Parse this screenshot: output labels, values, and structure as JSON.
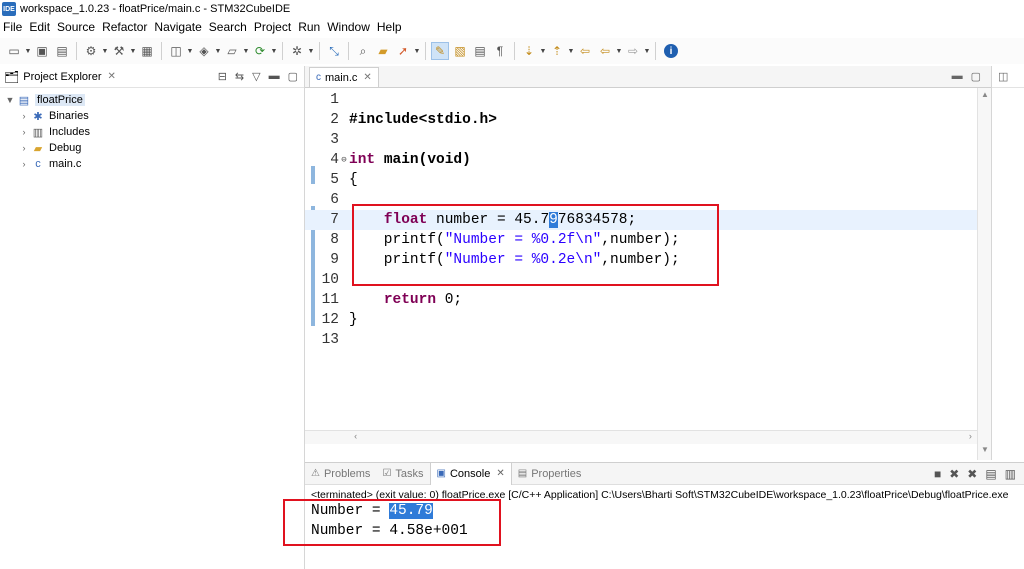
{
  "window": {
    "title": "workspace_1.0.23 - floatPrice/main.c - STM32CubeIDE",
    "app_icon": "IDE"
  },
  "menu": [
    "File",
    "Edit",
    "Source",
    "Refactor",
    "Navigate",
    "Search",
    "Project",
    "Run",
    "Window",
    "Help"
  ],
  "explorer": {
    "title": "Project Explorer",
    "tree": [
      {
        "label": "floatPrice",
        "icon": "project-icon",
        "expanded": true
      },
      {
        "label": "Binaries",
        "icon": "binaries-icon"
      },
      {
        "label": "Includes",
        "icon": "includes-icon"
      },
      {
        "label": "Debug",
        "icon": "folder-icon"
      },
      {
        "label": "main.c",
        "icon": "c-file-icon"
      }
    ]
  },
  "editor": {
    "tab": "main.c",
    "current_line": 7,
    "lines": [
      {
        "n": "1",
        "t": ""
      },
      {
        "n": "2",
        "t": "#include<stdio.h>"
      },
      {
        "n": "3",
        "t": ""
      },
      {
        "n": "4",
        "t": "int main(void)"
      },
      {
        "n": "5",
        "t": "{"
      },
      {
        "n": "6",
        "t": ""
      },
      {
        "n": "7",
        "t": "    float number = 45.7976834578;"
      },
      {
        "n": "8",
        "t": "    printf(\"Number = %0.2f\\n\",number);"
      },
      {
        "n": "9",
        "t": "    printf(\"Number = %0.2e\\n\",number);"
      },
      {
        "n": "10",
        "t": ""
      },
      {
        "n": "11",
        "t": "    return 0;"
      },
      {
        "n": "12",
        "t": "}"
      },
      {
        "n": "13",
        "t": ""
      }
    ]
  },
  "console": {
    "tabs": [
      "Problems",
      "Tasks",
      "Console",
      "Properties"
    ],
    "active_tab": "Console",
    "terminated": "<terminated> (exit value: 0) floatPrice.exe [C/C++ Application] C:\\Users\\Bharti Soft\\STM32CubeIDE\\workspace_1.0.23\\floatPrice\\Debug\\floatPrice.exe",
    "output": [
      {
        "prefix": "Number = ",
        "value": "45.79"
      },
      {
        "prefix": "Number = ",
        "value": "4.58e+001"
      }
    ]
  },
  "colors": {
    "keyword": "#7f0055",
    "string": "#2a00ff",
    "highlight_box": "#e0121f",
    "selection": "#2f7bd8"
  }
}
